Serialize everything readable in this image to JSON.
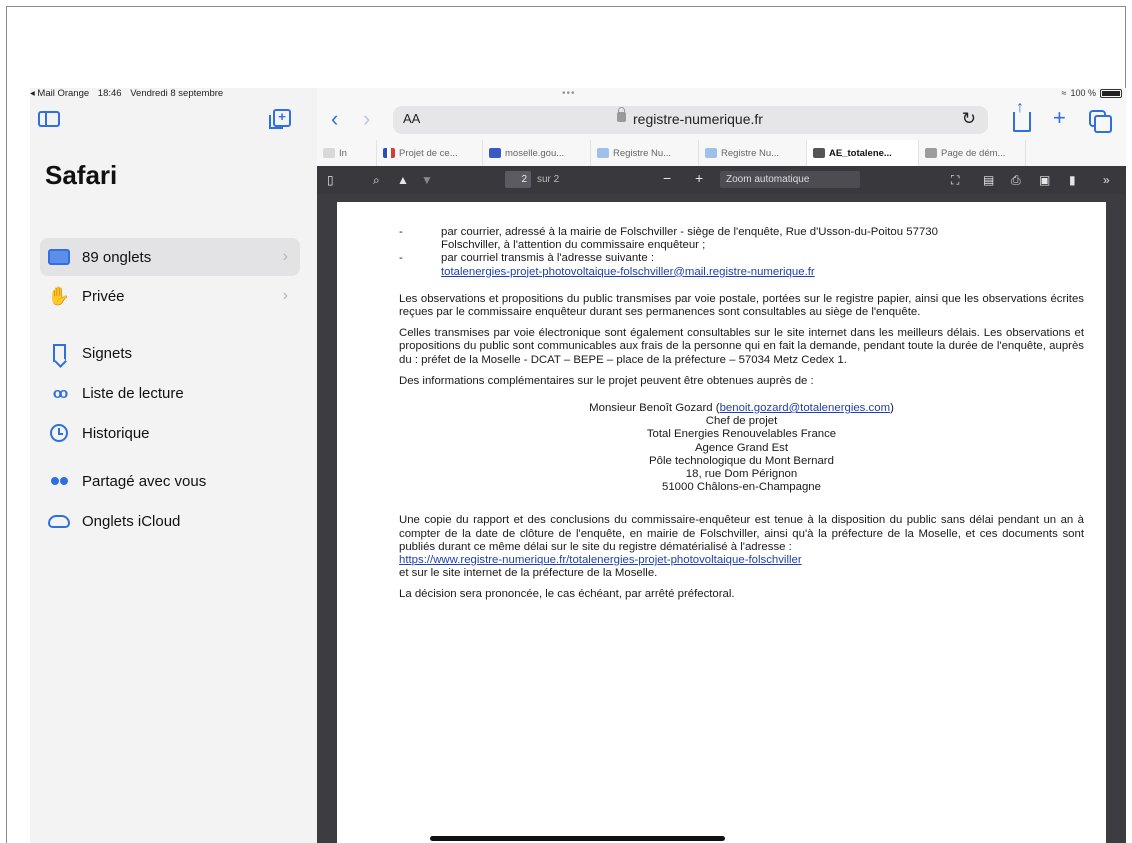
{
  "status": {
    "back_app": "◂ Mail Orange",
    "time": "18:46",
    "date": "Vendredi 8 septembre",
    "battery": "100 %"
  },
  "sidebar": {
    "title": "Safari",
    "items": [
      {
        "label": "89 onglets",
        "icon": "tabs-icon"
      },
      {
        "label": "Privée",
        "icon": "hand-icon"
      },
      {
        "label": "Signets",
        "icon": "bookmark-icon"
      },
      {
        "label": "Liste de lecture",
        "icon": "glasses-icon"
      },
      {
        "label": "Historique",
        "icon": "clock-icon"
      },
      {
        "label": "Partagé avec vous",
        "icon": "people-icon"
      },
      {
        "label": "Onglets iCloud",
        "icon": "cloud-icon"
      }
    ]
  },
  "toolbar": {
    "dots": "•••",
    "text_size": "AA",
    "domain": "registre-numerique.fr"
  },
  "tabs": [
    {
      "label": "In",
      "color": "#d9d9d9"
    },
    {
      "label": "Projet de ce...",
      "color": "#d93b3b"
    },
    {
      "label": "moselle.gou...",
      "color": "#3a59c9"
    },
    {
      "label": "Registre Nu...",
      "color": "#9fc0e8"
    },
    {
      "label": "Registre Nu...",
      "color": "#9fc0e8"
    },
    {
      "label": "AE_totalene...",
      "color": "#555555"
    },
    {
      "label": "Page de dém...",
      "color": "#9c9c9c"
    }
  ],
  "pdfbar": {
    "page": "2",
    "of": "sur 2",
    "zoom": "Zoom automatique"
  },
  "doc": {
    "bullet1_l1": "par courrier, adressé à la mairie de Folschviller - siège de l'enquête, Rue d'Usson-du-Poitou 57730",
    "bullet1_l2": "Folschviller, à l'attention du commissaire enquêteur ;",
    "bullet2_l1": "par courriel transmis à l'adresse suivante :",
    "bullet2_link": "totalenergies-projet-photovoltaique-folschviller@mail.registre-numerique.fr",
    "para1": "Les observations et propositions du public transmises par voie postale, portées sur le registre papier, ainsi que les observations écrites reçues par le commissaire enquêteur durant ses permanences sont consultables au siège de l'enquête.",
    "para2": "Celles transmises par voie électronique sont également consultables sur le site internet dans les meilleurs délais. Les observations et propositions du public sont communicables aux frais de la personne qui en fait la demande, pendant toute la durée de l'enquête, auprès du : préfet de la Moselle - DCAT – BEPE – place de la préfecture – 57034 Metz Cedex 1.",
    "para3": "Des informations complémentaires sur le projet peuvent être obtenues auprès de :",
    "contact_name": "Monsieur Benoît Gozard (",
    "contact_email": "benoit.gozard@totalenergies.com",
    "contact_close": ")",
    "contact_lines": [
      "Chef de projet",
      "Total Energies Renouvelables France",
      "Agence Grand Est",
      "Pôle technologique du Mont Bernard",
      "18, rue Dom Pérignon",
      "51000 Châlons-en-Champagne"
    ],
    "para4": "Une copie du rapport et des conclusions du commissaire-enquêteur est tenue à la disposition du public sans délai pendant un an à compter de la date de clôture de l'enquête, en mairie de Folschviller, ainsi qu'à la préfecture de la Moselle, et ces documents sont publiés durant ce même délai sur le site du registre dématérialisé à l'adresse :",
    "para4_link": "https://www.registre-numerique.fr/totalenergies-projet-photovoltaique-folschviller",
    "para4_end": "et sur le site internet de la préfecture de la Moselle.",
    "para5": "La décision sera prononcée, le cas échéant, par arrêté préfectoral."
  }
}
